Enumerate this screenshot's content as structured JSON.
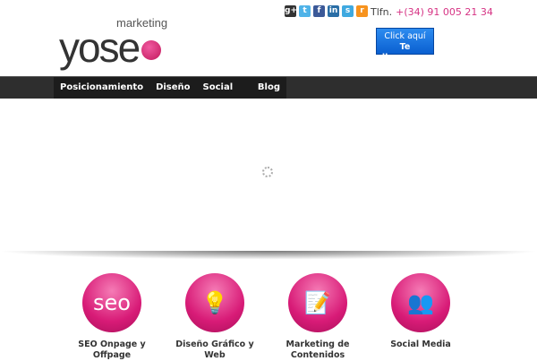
{
  "logo": {
    "top": "marketing",
    "main": "yose"
  },
  "social": [
    {
      "name": "google-plus",
      "glyph": "g+",
      "color": "#333333"
    },
    {
      "name": "twitter",
      "glyph": "t",
      "color": "#4fb3e8"
    },
    {
      "name": "facebook",
      "glyph": "f",
      "color": "#3b5998"
    },
    {
      "name": "linkedin",
      "glyph": "in",
      "color": "#2a6ea6"
    },
    {
      "name": "skype",
      "glyph": "s",
      "color": "#3fa9e0"
    },
    {
      "name": "rss",
      "glyph": "r",
      "color": "#f7931e"
    }
  ],
  "phone": {
    "label": "Tlfn.",
    "number": "+(34) 91 005 21 34"
  },
  "callback": {
    "line1": "Click aquí",
    "line2": "Te llamamos"
  },
  "nav": [
    "Posicionamiento Web",
    "Diseño",
    "Social Media",
    "Blog"
  ],
  "features": [
    {
      "title": "SEO Onpage y Offpage",
      "icon": "seo"
    },
    {
      "title": "Diseño Gráfico y Web",
      "icon": "💡"
    },
    {
      "title": "Marketing de Contenidos",
      "icon": "📝"
    },
    {
      "title": "Social Media",
      "icon": "👥"
    }
  ]
}
